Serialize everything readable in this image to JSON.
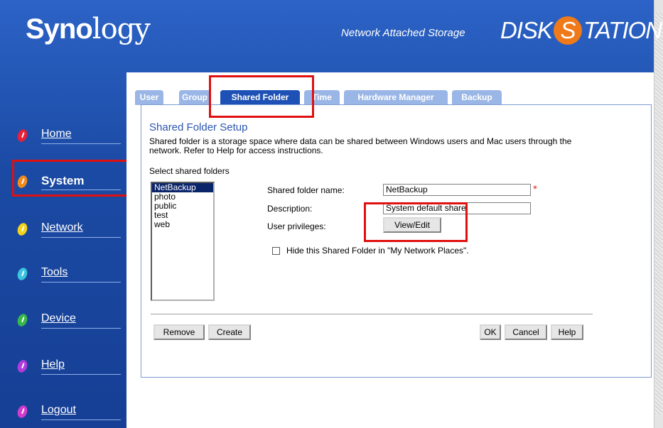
{
  "header": {
    "logo_main": "Syno",
    "logo_rest": "logy",
    "tagline": "Network Attached Storage",
    "brand_left": "DISK",
    "brand_s": "S",
    "brand_right": "TATION"
  },
  "nav": {
    "items": [
      {
        "label": "Home",
        "color": "#e8203a"
      },
      {
        "label": "System",
        "color": "#f08a1e"
      },
      {
        "label": "Network",
        "color": "#f2d21b"
      },
      {
        "label": "Tools",
        "color": "#3bc4dc"
      },
      {
        "label": "Device",
        "color": "#38b84a"
      },
      {
        "label": "Help",
        "color": "#b03cdc"
      },
      {
        "label": "Logout",
        "color": "#d23ccc"
      }
    ],
    "active": "System"
  },
  "tabs": [
    "User",
    "Group",
    "Shared Folder",
    "Time",
    "Hardware Manager",
    "Backup"
  ],
  "active_tab": "Shared Folder",
  "section": {
    "title": "Shared Folder Setup",
    "description": "Shared folder is a storage space where data can be shared between Windows users and Mac users through the network. Refer to Help for access instructions.",
    "select_label": "Select shared folders"
  },
  "folders": [
    "NetBackup",
    "photo",
    "public",
    "test",
    "web"
  ],
  "selected_folder": "NetBackup",
  "form": {
    "name_label": "Shared folder name:",
    "name_value": "NetBackup",
    "desc_label": "Description:",
    "desc_value": "System default share",
    "priv_label": "User privileges:",
    "view_edit": "View/Edit",
    "required_mark": "*",
    "hide_label": "Hide this Shared Folder in \"My Network Places\"."
  },
  "buttons": {
    "remove": "Remove",
    "create": "Create",
    "ok": "OK",
    "cancel": "Cancel",
    "help": "Help"
  }
}
